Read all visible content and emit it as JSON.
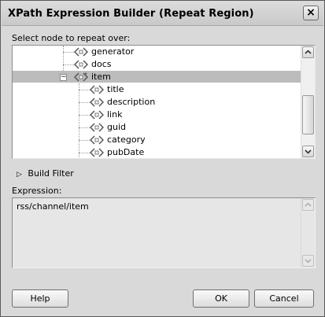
{
  "window": {
    "title": "XPath Expression Builder (Repeat Region)"
  },
  "title_bar": {
    "close_glyph": "×"
  },
  "tree_label": "Select node to repeat over:",
  "tree": {
    "nodes": [
      {
        "label": "generator",
        "icon": "xml-element-icon",
        "selected": false
      },
      {
        "label": "docs",
        "icon": "xml-element-icon",
        "selected": false
      },
      {
        "label": "item",
        "icon": "xml-repeating-element-icon",
        "selected": true,
        "expanded": true
      },
      {
        "label": "title",
        "icon": "xml-element-icon",
        "selected": false
      },
      {
        "label": "description",
        "icon": "xml-element-icon",
        "selected": false
      },
      {
        "label": "link",
        "icon": "xml-element-icon",
        "selected": false
      },
      {
        "label": "guid",
        "icon": "xml-element-icon",
        "selected": false
      },
      {
        "label": "category",
        "icon": "xml-element-icon",
        "selected": false
      },
      {
        "label": "pubDate",
        "icon": "xml-element-icon",
        "selected": false
      }
    ],
    "expander_glyph": "−",
    "scroll_position": 0.78
  },
  "build_filter": {
    "label": "Build Filter",
    "glyph": "▷"
  },
  "expression": {
    "label": "Expression:",
    "value": "rss/channel/item"
  },
  "buttons": {
    "help": "Help",
    "ok": "OK",
    "cancel": "Cancel"
  },
  "colors": {
    "selection": "#bcbcbc",
    "window_bg": "#d9d9d9"
  }
}
